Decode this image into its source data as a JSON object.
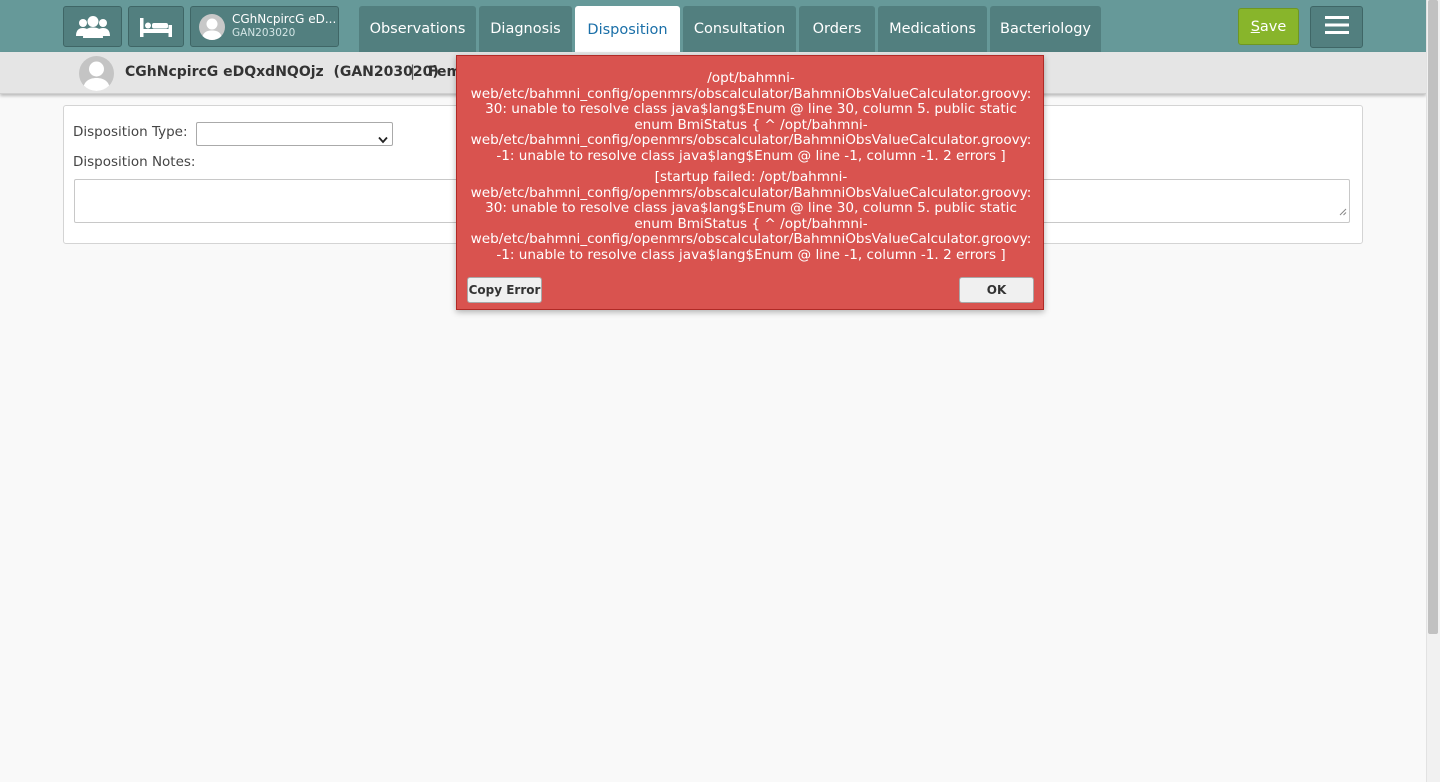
{
  "nav": {
    "patient_name_short": "CGhNcpircG eD...",
    "patient_id": "GAN203020",
    "tabs": [
      {
        "label": "Observations"
      },
      {
        "label": "Diagnosis"
      },
      {
        "label": "Disposition"
      },
      {
        "label": "Consultation"
      },
      {
        "label": "Orders"
      },
      {
        "label": "Medications"
      },
      {
        "label": "Bacteriology"
      }
    ],
    "active_tab": "Disposition",
    "save_hotkey": "S",
    "save_rest": "ave",
    "icons": {
      "patients": "users-icon",
      "beds": "bed-icon",
      "avatar": "user-avatar-icon",
      "menu": "hamburger-menu-icon"
    }
  },
  "patient_header": {
    "name": "CGhNcpircG eDQxdNQOjz",
    "id_display": "(GAN203020)",
    "separator": "|",
    "gender_partial": "Fem"
  },
  "disposition": {
    "type_label": "Disposition Type:",
    "type_value": "",
    "notes_label": "Disposition Notes:",
    "notes_value": ""
  },
  "error_dialog": {
    "message1": "/opt/bahmni-web/etc/bahmni_config/openmrs/obscalculator/BahmniObsValueCalculator.groovy: 30: unable to resolve class java$lang$Enum @ line 30, column 5. public static enum BmiStatus { ^ /opt/bahmni-web/etc/bahmni_config/openmrs/obscalculator/BahmniObsValueCalculator.groovy: -1: unable to resolve class java$lang$Enum @ line -1, column -1. 2 errors ]",
    "message2": "[startup failed: /opt/bahmni-web/etc/bahmni_config/openmrs/obscalculator/BahmniObsValueCalculator.groovy: 30: unable to resolve class java$lang$Enum @ line 30, column 5. public static enum BmiStatus { ^ /opt/bahmni-web/etc/bahmni_config/openmrs/obscalculator/BahmniObsValueCalculator.groovy: -1: unable to resolve class java$lang$Enum @ line -1, column -1. 2 errors ]",
    "copy_label": "Copy Error",
    "ok_label": "OK"
  },
  "colors": {
    "topbar": "#669999",
    "tab": "#527f7f",
    "save": "#88b52b",
    "error": "#d9534f"
  }
}
